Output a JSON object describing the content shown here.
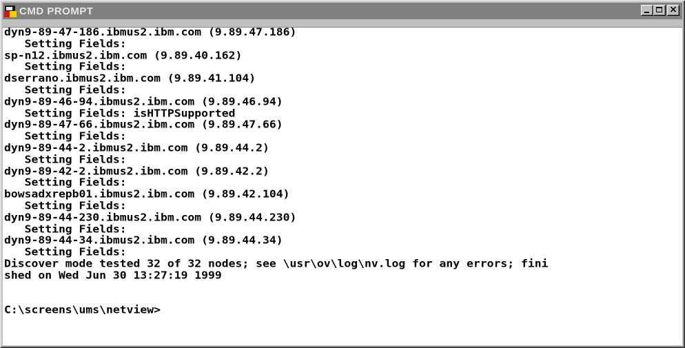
{
  "window": {
    "title": "CMD PROMPT",
    "icon": "msdos-icon",
    "buttons": {
      "minimize": "minimize-icon",
      "maximize": "maximize-icon",
      "close": "close-icon"
    }
  },
  "console": {
    "lines": [
      "dyn9-89-47-186.ibmus2.ibm.com (9.89.47.186)",
      "   Setting Fields:",
      "sp-n12.ibmus2.ibm.com (9.89.40.162)",
      "   Setting Fields:",
      "dserrano.ibmus2.ibm.com (9.89.41.104)",
      "   Setting Fields:",
      "dyn9-89-46-94.ibmus2.ibm.com (9.89.46.94)",
      "   Setting Fields: isHTTPSupported",
      "dyn9-89-47-66.ibmus2.ibm.com (9.89.47.66)",
      "   Setting Fields:",
      "dyn9-89-44-2.ibmus2.ibm.com (9.89.44.2)",
      "   Setting Fields:",
      "dyn9-89-42-2.ibmus2.ibm.com (9.89.42.2)",
      "   Setting Fields:",
      "bowsadxrepb01.ibmus2.ibm.com (9.89.42.104)",
      "   Setting Fields:",
      "dyn9-89-44-230.ibmus2.ibm.com (9.89.44.230)",
      "   Setting Fields:",
      "dyn9-89-44-34.ibmus2.ibm.com (9.89.44.34)",
      "   Setting Fields:",
      "Discover mode tested 32 of 32 nodes; see \\usr\\ov\\log\\nv.log for any errors; fini",
      "shed on Wed Jun 30 13:27:19 1999",
      "",
      "",
      "C:\\screens\\ums\\netview>"
    ]
  }
}
